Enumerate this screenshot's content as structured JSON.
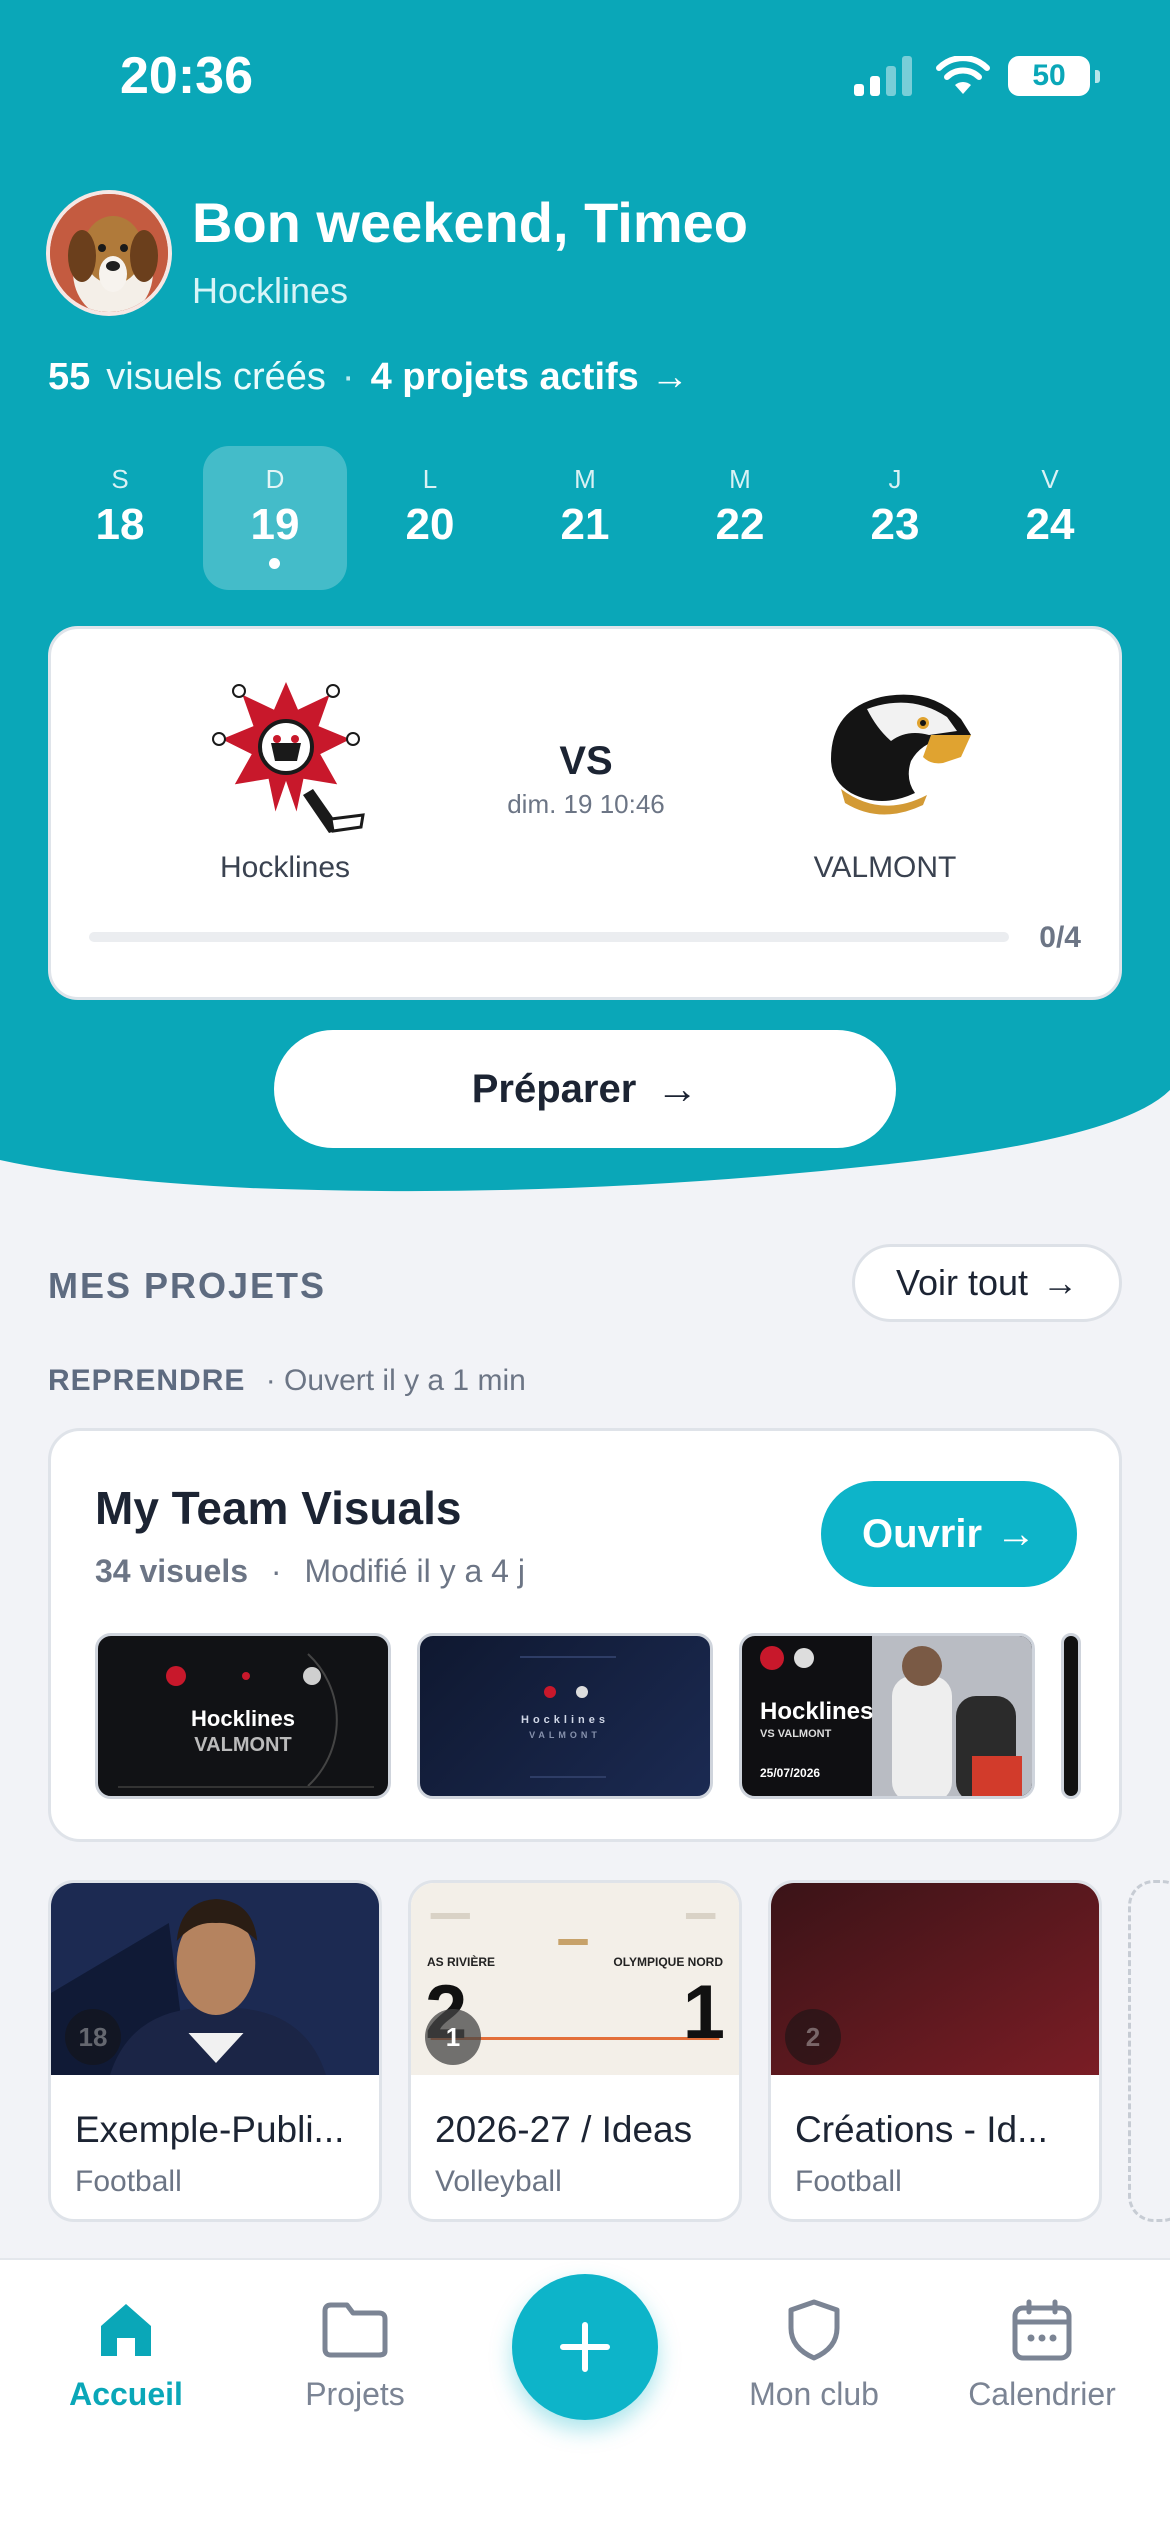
{
  "status_bar": {
    "time": "20:36",
    "battery": "50"
  },
  "header": {
    "greeting": "Bon weekend, Timeo",
    "club": "Hocklines",
    "stats": {
      "visuals_count": "55",
      "visuals_label": "visuels créés",
      "separator": "·",
      "projects": "4 projets actifs",
      "arrow": "→"
    }
  },
  "calendar": {
    "days": [
      {
        "weekday": "S",
        "date": "18"
      },
      {
        "weekday": "D",
        "date": "19"
      },
      {
        "weekday": "L",
        "date": "20"
      },
      {
        "weekday": "M",
        "date": "21"
      },
      {
        "weekday": "M",
        "date": "22"
      },
      {
        "weekday": "J",
        "date": "23"
      },
      {
        "weekday": "V",
        "date": "24"
      }
    ],
    "selected_index": 1
  },
  "match": {
    "home_team": "Hocklines",
    "away_team": "VALMONT",
    "vs": "VS",
    "datetime": "dim. 19 10:46",
    "progress_label": "0/4",
    "progress_fraction": 0
  },
  "prepare_button": {
    "label": "Préparer",
    "arrow": "→"
  },
  "projects_section": {
    "title": "MES PROJETS",
    "see_all": "Voir tout",
    "see_all_arrow": "→",
    "resume_label": "REPRENDRE",
    "resume_detail": "· Ouvert il y a 1 min",
    "featured": {
      "title": "My Team Visuals",
      "count": "34 visuels",
      "separator": "·",
      "modified": "Modifié il y a 4 j",
      "open_label": "Ouvrir",
      "open_arrow": "→",
      "thumb_texts": {
        "t1_line1": "Hocklines",
        "t1_line2": "VALMONT",
        "t2_line1": "Hocklines",
        "t2_line2": "VALMONT",
        "t3_line1": "Hocklines",
        "t3_line2": "VS VALMONT",
        "t3_line3": "25/07/2026"
      }
    },
    "cards": [
      {
        "name": "Exemple-Publi...",
        "sport": "Football",
        "badge": "18"
      },
      {
        "name": "2026-27 / Ideas",
        "sport": "Volleyball",
        "badge": "1",
        "cover_home": "AS RIVIÈRE",
        "cover_away": "OLYMPIQUE NORD",
        "cover_home_score": "2",
        "cover_away_score": "1"
      },
      {
        "name": "Créations - Id...",
        "sport": "Football",
        "badge": "2"
      }
    ]
  },
  "tab_bar": {
    "items": [
      {
        "label": "Accueil",
        "icon": "home-icon"
      },
      {
        "label": "Projets",
        "icon": "folder-icon"
      },
      {
        "label": "",
        "icon": "plus-icon"
      },
      {
        "label": "Mon club",
        "icon": "shield-icon"
      },
      {
        "label": "Calendrier",
        "icon": "calendar-icon"
      }
    ]
  },
  "colors": {
    "accent": "#0aa7b8",
    "button_accent": "#0db4c9",
    "background": "#f2f3f7",
    "text": "#1c2433",
    "muted": "#6c7585"
  }
}
